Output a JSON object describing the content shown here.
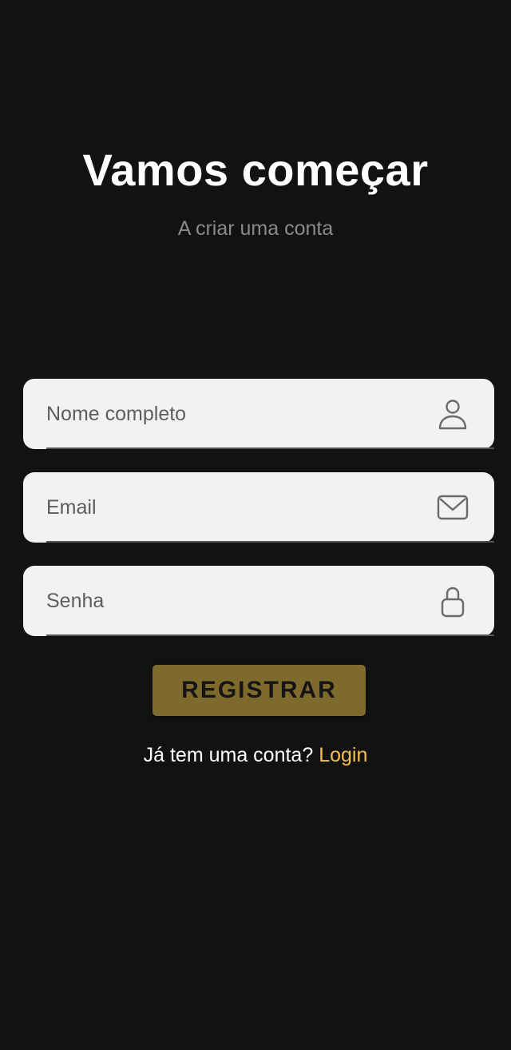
{
  "header": {
    "title": "Vamos começar",
    "subtitle": "A criar uma conta"
  },
  "form": {
    "fields": [
      {
        "placeholder": "Nome completo",
        "icon": "user-icon"
      },
      {
        "placeholder": "Email",
        "icon": "mail-icon"
      },
      {
        "placeholder": "Senha",
        "icon": "lock-icon"
      }
    ],
    "register_label": "REGISTRAR"
  },
  "footer": {
    "question": "Já tem uma conta?",
    "login_label": "Login"
  },
  "colors": {
    "background": "#121212",
    "field_background": "#f2f2f2",
    "button": "#7f6a2d",
    "link": "#f4c052",
    "subtitle": "#8a8a8a"
  }
}
